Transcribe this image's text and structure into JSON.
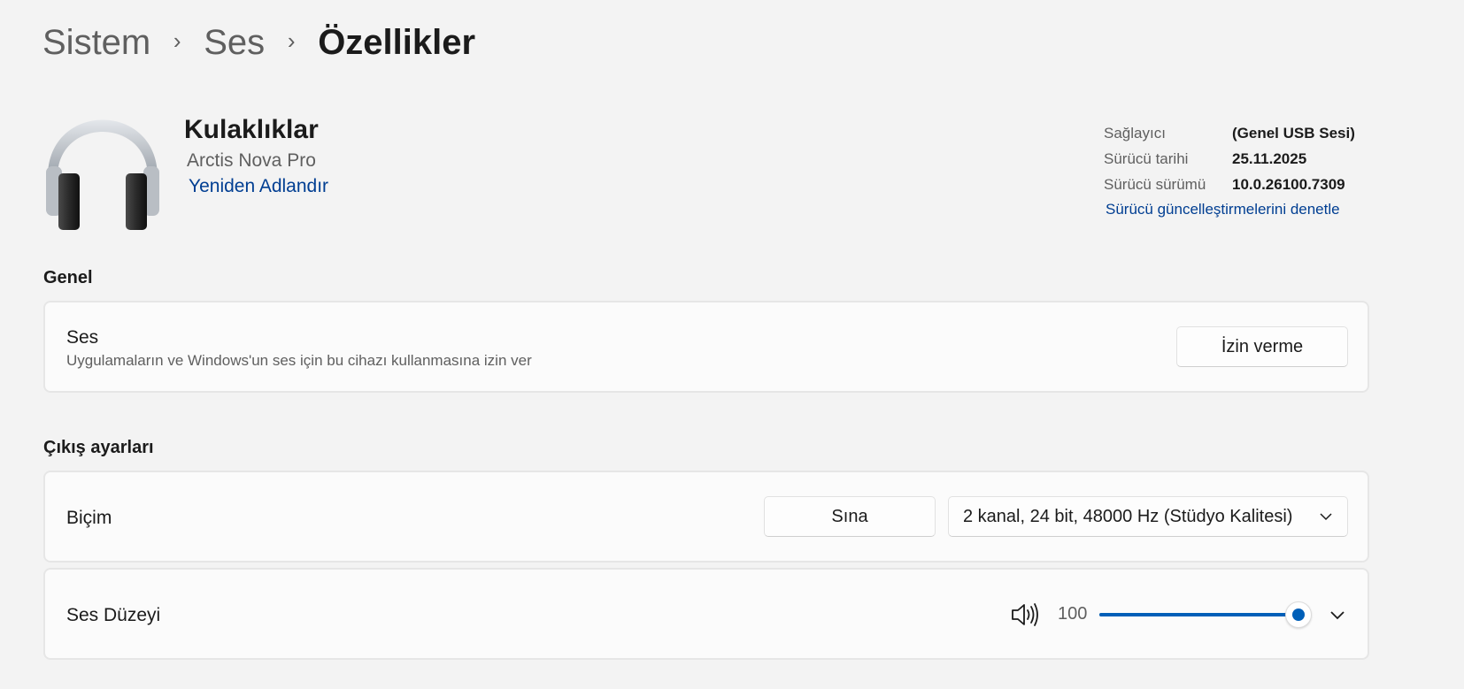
{
  "breadcrumb": {
    "items": [
      "Sistem",
      "Ses"
    ],
    "current": "Özellikler",
    "separator": "›"
  },
  "device": {
    "icon": "headphones-icon",
    "name": "Kulaklıklar",
    "model": "Arctis Nova Pro",
    "rename_label": "Yeniden Adlandır"
  },
  "driver": {
    "rows": [
      {
        "label": "Sağlayıcı",
        "value": "(Genel USB Sesi)"
      },
      {
        "label": "Sürücü tarihi",
        "value": "25.11.2025"
      },
      {
        "label": "Sürücü sürümü",
        "value": "10.0.26100.7309"
      }
    ],
    "update_link": "Sürücü güncelleştirmelerini denetle"
  },
  "general": {
    "section_title": "Genel",
    "audio": {
      "title": "Ses",
      "description": "Uygulamaların ve Windows'un ses için bu cihazı kullanmasına izin ver",
      "button_label": "İzin verme"
    }
  },
  "output": {
    "section_title": "Çıkış ayarları",
    "format": {
      "title": "Biçim",
      "test_button": "Sına",
      "selected_format": "2 kanal, 24 bit, 48000 Hz (Stüdyo Kalitesi)"
    },
    "volume": {
      "title": "Ses Düzeyi",
      "icon": "speaker-volume-icon",
      "value": "100",
      "level_percent": 100
    }
  },
  "colors": {
    "accent": "#005fb8",
    "link": "#003e92",
    "background": "#f3f3f3",
    "card": "#fbfbfb"
  }
}
